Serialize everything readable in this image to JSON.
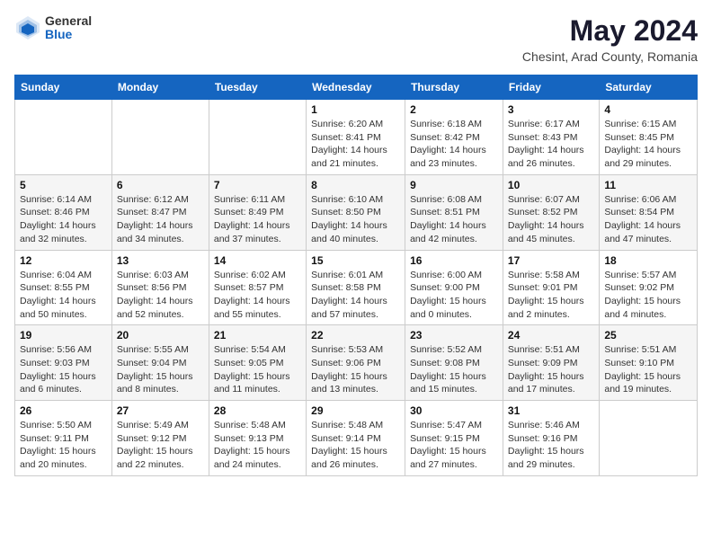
{
  "header": {
    "logo_general": "General",
    "logo_blue": "Blue",
    "title": "May 2024",
    "subtitle": "Chesint, Arad County, Romania"
  },
  "days_of_week": [
    "Sunday",
    "Monday",
    "Tuesday",
    "Wednesday",
    "Thursday",
    "Friday",
    "Saturday"
  ],
  "weeks": [
    [
      {
        "day": "",
        "info": ""
      },
      {
        "day": "",
        "info": ""
      },
      {
        "day": "",
        "info": ""
      },
      {
        "day": "1",
        "info": "Sunrise: 6:20 AM\nSunset: 8:41 PM\nDaylight: 14 hours\nand 21 minutes."
      },
      {
        "day": "2",
        "info": "Sunrise: 6:18 AM\nSunset: 8:42 PM\nDaylight: 14 hours\nand 23 minutes."
      },
      {
        "day": "3",
        "info": "Sunrise: 6:17 AM\nSunset: 8:43 PM\nDaylight: 14 hours\nand 26 minutes."
      },
      {
        "day": "4",
        "info": "Sunrise: 6:15 AM\nSunset: 8:45 PM\nDaylight: 14 hours\nand 29 minutes."
      }
    ],
    [
      {
        "day": "5",
        "info": "Sunrise: 6:14 AM\nSunset: 8:46 PM\nDaylight: 14 hours\nand 32 minutes."
      },
      {
        "day": "6",
        "info": "Sunrise: 6:12 AM\nSunset: 8:47 PM\nDaylight: 14 hours\nand 34 minutes."
      },
      {
        "day": "7",
        "info": "Sunrise: 6:11 AM\nSunset: 8:49 PM\nDaylight: 14 hours\nand 37 minutes."
      },
      {
        "day": "8",
        "info": "Sunrise: 6:10 AM\nSunset: 8:50 PM\nDaylight: 14 hours\nand 40 minutes."
      },
      {
        "day": "9",
        "info": "Sunrise: 6:08 AM\nSunset: 8:51 PM\nDaylight: 14 hours\nand 42 minutes."
      },
      {
        "day": "10",
        "info": "Sunrise: 6:07 AM\nSunset: 8:52 PM\nDaylight: 14 hours\nand 45 minutes."
      },
      {
        "day": "11",
        "info": "Sunrise: 6:06 AM\nSunset: 8:54 PM\nDaylight: 14 hours\nand 47 minutes."
      }
    ],
    [
      {
        "day": "12",
        "info": "Sunrise: 6:04 AM\nSunset: 8:55 PM\nDaylight: 14 hours\nand 50 minutes."
      },
      {
        "day": "13",
        "info": "Sunrise: 6:03 AM\nSunset: 8:56 PM\nDaylight: 14 hours\nand 52 minutes."
      },
      {
        "day": "14",
        "info": "Sunrise: 6:02 AM\nSunset: 8:57 PM\nDaylight: 14 hours\nand 55 minutes."
      },
      {
        "day": "15",
        "info": "Sunrise: 6:01 AM\nSunset: 8:58 PM\nDaylight: 14 hours\nand 57 minutes."
      },
      {
        "day": "16",
        "info": "Sunrise: 6:00 AM\nSunset: 9:00 PM\nDaylight: 15 hours\nand 0 minutes."
      },
      {
        "day": "17",
        "info": "Sunrise: 5:58 AM\nSunset: 9:01 PM\nDaylight: 15 hours\nand 2 minutes."
      },
      {
        "day": "18",
        "info": "Sunrise: 5:57 AM\nSunset: 9:02 PM\nDaylight: 15 hours\nand 4 minutes."
      }
    ],
    [
      {
        "day": "19",
        "info": "Sunrise: 5:56 AM\nSunset: 9:03 PM\nDaylight: 15 hours\nand 6 minutes."
      },
      {
        "day": "20",
        "info": "Sunrise: 5:55 AM\nSunset: 9:04 PM\nDaylight: 15 hours\nand 8 minutes."
      },
      {
        "day": "21",
        "info": "Sunrise: 5:54 AM\nSunset: 9:05 PM\nDaylight: 15 hours\nand 11 minutes."
      },
      {
        "day": "22",
        "info": "Sunrise: 5:53 AM\nSunset: 9:06 PM\nDaylight: 15 hours\nand 13 minutes."
      },
      {
        "day": "23",
        "info": "Sunrise: 5:52 AM\nSunset: 9:08 PM\nDaylight: 15 hours\nand 15 minutes."
      },
      {
        "day": "24",
        "info": "Sunrise: 5:51 AM\nSunset: 9:09 PM\nDaylight: 15 hours\nand 17 minutes."
      },
      {
        "day": "25",
        "info": "Sunrise: 5:51 AM\nSunset: 9:10 PM\nDaylight: 15 hours\nand 19 minutes."
      }
    ],
    [
      {
        "day": "26",
        "info": "Sunrise: 5:50 AM\nSunset: 9:11 PM\nDaylight: 15 hours\nand 20 minutes."
      },
      {
        "day": "27",
        "info": "Sunrise: 5:49 AM\nSunset: 9:12 PM\nDaylight: 15 hours\nand 22 minutes."
      },
      {
        "day": "28",
        "info": "Sunrise: 5:48 AM\nSunset: 9:13 PM\nDaylight: 15 hours\nand 24 minutes."
      },
      {
        "day": "29",
        "info": "Sunrise: 5:48 AM\nSunset: 9:14 PM\nDaylight: 15 hours\nand 26 minutes."
      },
      {
        "day": "30",
        "info": "Sunrise: 5:47 AM\nSunset: 9:15 PM\nDaylight: 15 hours\nand 27 minutes."
      },
      {
        "day": "31",
        "info": "Sunrise: 5:46 AM\nSunset: 9:16 PM\nDaylight: 15 hours\nand 29 minutes."
      },
      {
        "day": "",
        "info": ""
      }
    ]
  ]
}
